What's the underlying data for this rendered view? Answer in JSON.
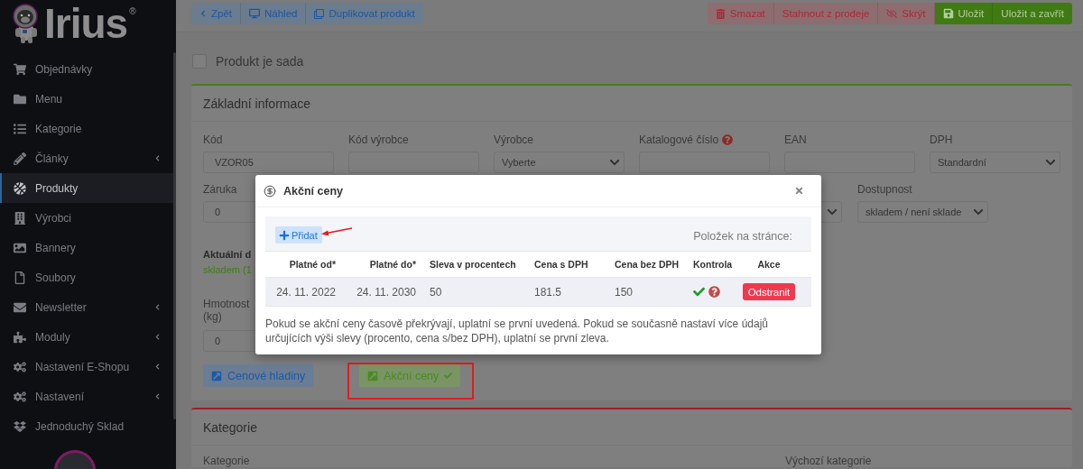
{
  "sidebar": {
    "logo": {
      "text": "Irius",
      "mark": "®"
    },
    "items": [
      {
        "label": "Objednávky",
        "selected": false,
        "submenu": false
      },
      {
        "label": "Menu",
        "selected": false,
        "submenu": false
      },
      {
        "label": "Kategorie",
        "selected": false,
        "submenu": false
      },
      {
        "label": "Články",
        "selected": false,
        "submenu": true
      },
      {
        "label": "Produkty",
        "selected": true,
        "submenu": false
      },
      {
        "label": "Výrobci",
        "selected": false,
        "submenu": false
      },
      {
        "label": "Bannery",
        "selected": false,
        "submenu": false
      },
      {
        "label": "Soubory",
        "selected": false,
        "submenu": false
      },
      {
        "label": "Newsletter",
        "selected": false,
        "submenu": true
      },
      {
        "label": "Moduly",
        "selected": false,
        "submenu": true
      },
      {
        "label": "Nastavení E-Shopu",
        "selected": false,
        "submenu": true
      },
      {
        "label": "Nastavení",
        "selected": false,
        "submenu": true
      },
      {
        "label": "Jednoduchý Sklad",
        "selected": false,
        "submenu": false
      }
    ]
  },
  "toolbar": {
    "left_buttons": [
      {
        "label": "Zpět",
        "kind": "info"
      },
      {
        "label": "Náhled",
        "kind": "info"
      },
      {
        "label": "Duplikovat produkt",
        "kind": "info"
      }
    ],
    "right_buttons": [
      {
        "label": "Smazat",
        "kind": "danger"
      },
      {
        "label": "Stahnout z prodeje",
        "kind": "danger"
      },
      {
        "label": "Skrýt",
        "kind": "danger"
      },
      {
        "label": "Uložit",
        "kind": "success"
      },
      {
        "label": "Uložit a zavřít",
        "kind": "success"
      }
    ]
  },
  "set_checkbox": {
    "label": "Produkt je sada",
    "checked": false
  },
  "basic_info": {
    "title": "Základní informace",
    "fields": [
      {
        "label": "Kód",
        "kind": "text",
        "value": "VZOR05"
      },
      {
        "label": "Kód výrobce",
        "kind": "text"
      },
      {
        "label": "Výrobce",
        "kind": "select",
        "value": "Vyberte"
      },
      {
        "label": "Katalogové číslo",
        "kind": "text",
        "help": true
      },
      {
        "label": "EAN",
        "kind": "text"
      },
      {
        "label": "DPH",
        "kind": "select",
        "value": "Standardní"
      }
    ],
    "fields_row_2": [
      {
        "label": "Záruka",
        "kind": "text",
        "value": "0"
      },
      {
        "kind": "select"
      },
      {
        "label": "Dostupnost",
        "kind": "select",
        "value": "skladem / není sklade"
      }
    ],
    "availability": {
      "heading": "Aktuální d",
      "value": "skladem (1"
    },
    "weight": {
      "label": "Hmotnost (kg)",
      "kind": "text",
      "value": "0"
    },
    "buttons": [
      {
        "label": "Cenové hladiny",
        "kind": "info",
        "checked": false,
        "highlighted": false
      },
      {
        "label": "Akční ceny",
        "kind": "success",
        "checked": true,
        "highlighted": true
      }
    ]
  },
  "category": {
    "title": "Kategorie",
    "labels": [
      "Kategorie",
      "Výchozí kategorie"
    ]
  },
  "modal": {
    "title": "Akční ceny",
    "add_button": {
      "label": "Přidat",
      "annotated": true
    },
    "page_size_label": "Položek na stránce:",
    "columns": [
      "Platné od*",
      "Platné do*",
      "Sleva v procentech",
      "Cena s DPH",
      "Cena bez DPH",
      "Kontrola",
      "Akce"
    ],
    "rows": [
      {
        "cells": [
          "24. 11. 2022",
          "24. 11. 2030",
          "50",
          "181.5",
          "150"
        ],
        "valid": true,
        "action": "Odstranit"
      }
    ],
    "note": "Pokud se akční ceny časově překrývají, uplatní se první uvedená. Pokud se současně nastaví více údajů určujících výši slevy (procento, cena s/bez DPH), uplatní se první zleva."
  }
}
